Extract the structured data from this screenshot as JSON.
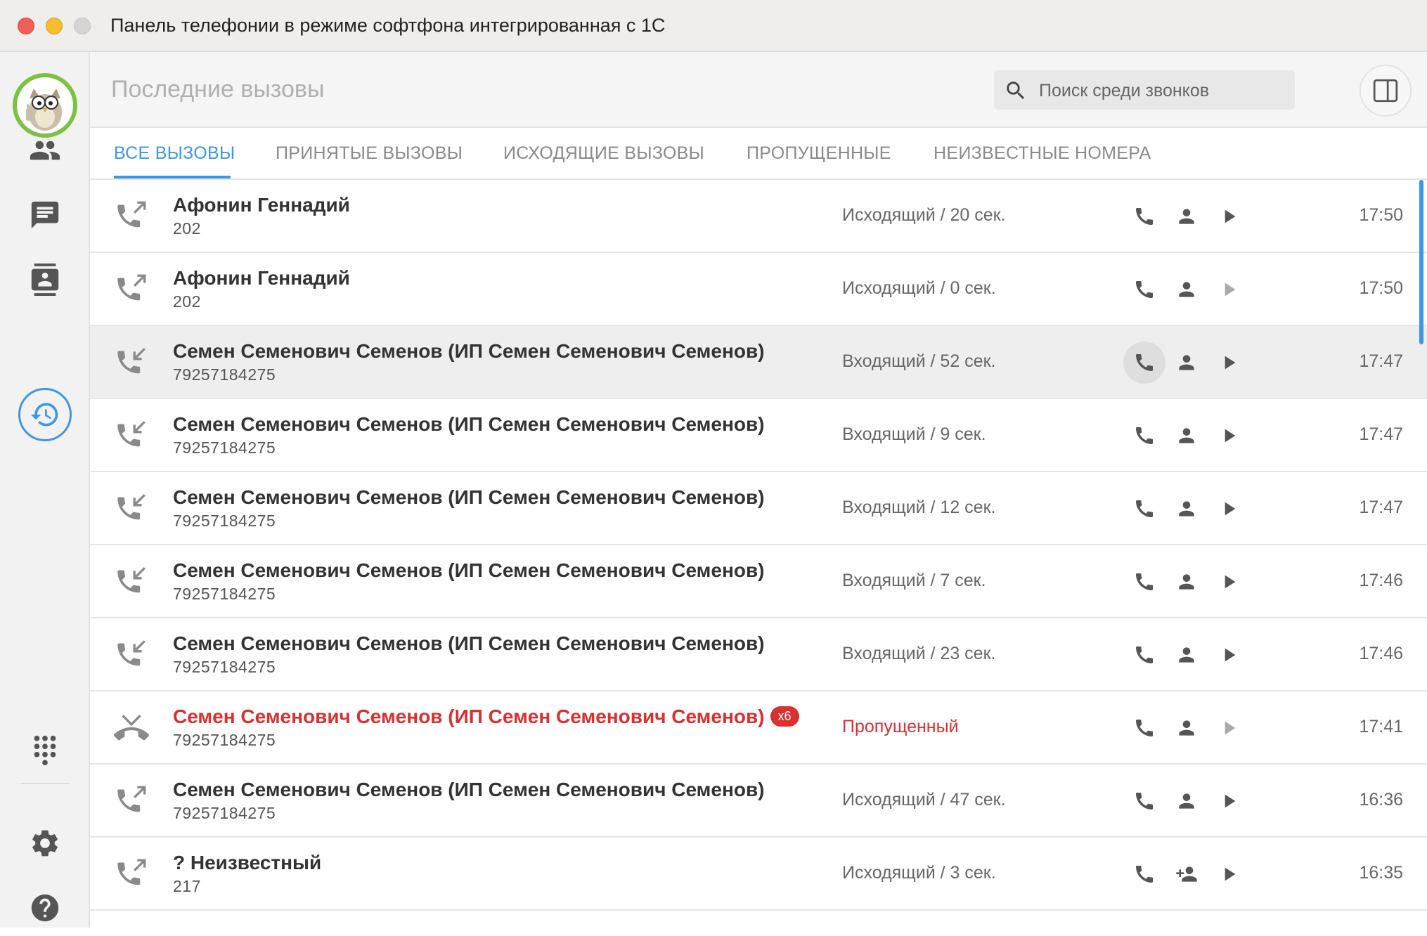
{
  "window": {
    "title": "Панель телефонии в режиме софтфона интегрированная с 1С"
  },
  "sidebar": {
    "items": [
      {
        "icon": "contacts-group-icon"
      },
      {
        "icon": "chat-icon"
      },
      {
        "icon": "address-book-icon"
      },
      {
        "icon": "history-icon",
        "active": true
      },
      {
        "icon": "dialpad-icon"
      },
      {
        "icon": "settings-icon"
      },
      {
        "icon": "help-icon"
      }
    ]
  },
  "header": {
    "title": "Последние вызовы",
    "search_placeholder": "Поиск среди звонков"
  },
  "tabs": [
    {
      "label": "ВСЕ ВЫЗОВЫ",
      "active": true
    },
    {
      "label": "ПРИНЯТЫЕ ВЫЗОВЫ"
    },
    {
      "label": "ИСХОДЯЩИЕ ВЫЗОВЫ"
    },
    {
      "label": "ПРОПУЩЕННЫЕ"
    },
    {
      "label": "НЕИЗВЕСТНЫЕ НОМЕРА"
    }
  ],
  "calls": [
    {
      "direction": "outgoing",
      "name": "Афонин Геннадий",
      "number": "202",
      "status": "Исходящий / 20 сек.",
      "time": "17:50"
    },
    {
      "direction": "outgoing",
      "name": "Афонин Геннадий",
      "number": "202",
      "status": "Исходящий / 0 сек.",
      "time": "17:50"
    },
    {
      "direction": "incoming",
      "name": "Семен Семенович Семенов (ИП Семен Семенович Семенов)",
      "number": "79257184275",
      "status": "Входящий / 52 сек.",
      "time": "17:47"
    },
    {
      "direction": "incoming",
      "name": "Семен Семенович Семенов (ИП Семен Семенович Семенов)",
      "number": "79257184275",
      "status": "Входящий / 9 сек.",
      "time": "17:47"
    },
    {
      "direction": "incoming",
      "name": "Семен Семенович Семенов (ИП Семен Семенович Семенов)",
      "number": "79257184275",
      "status": "Входящий / 12 сек.",
      "time": "17:47"
    },
    {
      "direction": "incoming",
      "name": "Семен Семенович Семенов (ИП Семен Семенович Семенов)",
      "number": "79257184275",
      "status": "Входящий / 7 сек.",
      "time": "17:46"
    },
    {
      "direction": "incoming",
      "name": "Семен Семенович Семенов (ИП Семен Семенович Семенов)",
      "number": "79257184275",
      "status": "Входящий / 23 сек.",
      "time": "17:46"
    },
    {
      "direction": "missed",
      "name": "Семен Семенович Семенов (ИП Семен Семенович Семенов)",
      "badge": "x6",
      "number": "79257184275",
      "status": "Пропущенный",
      "time": "17:41"
    },
    {
      "direction": "outgoing",
      "name": "Семен Семенович Семенов (ИП Семен Семенович Семенов)",
      "number": "79257184275",
      "status": "Исходящий / 47 сек.",
      "time": "16:36"
    },
    {
      "direction": "outgoing",
      "name": "? Неизвестный",
      "number": "217",
      "status": "Исходящий / 3 сек.",
      "time": "16:35"
    }
  ],
  "colors": {
    "accent": "#3d97e6",
    "missed": "#d93030",
    "avatar_ring": "#7cc242"
  }
}
